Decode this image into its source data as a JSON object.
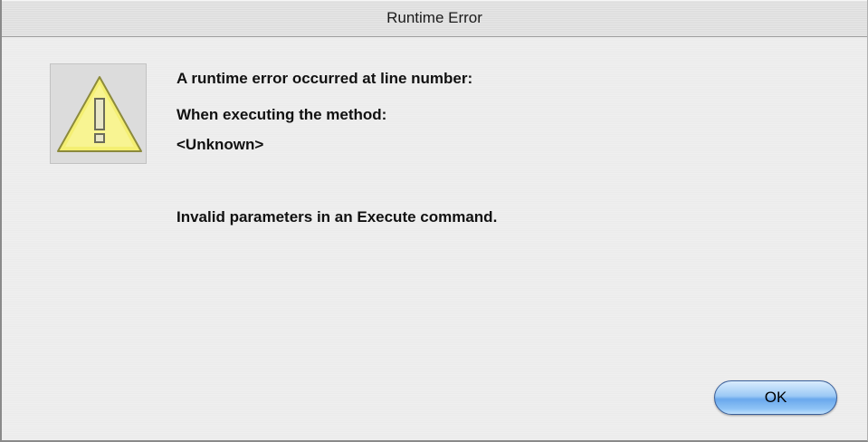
{
  "window": {
    "title": "Runtime Error"
  },
  "dialog": {
    "icon": "warning-triangle-icon",
    "line_number_label": "A runtime error occurred at line number:",
    "method_label": "When executing the method:",
    "method_value": "<Unknown>",
    "error_message": "Invalid parameters in an Execute command."
  },
  "buttons": {
    "ok_label": "OK"
  },
  "colors": {
    "warning_yellow": "#f5f07a",
    "button_blue": "#6aa8ec"
  }
}
